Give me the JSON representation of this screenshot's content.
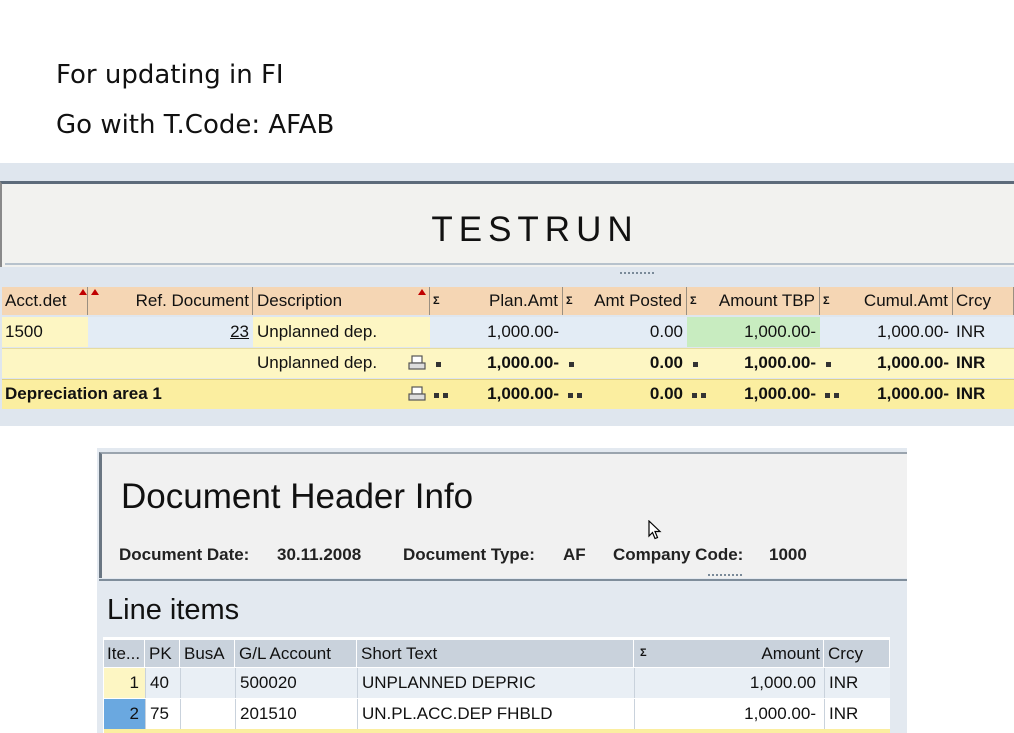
{
  "slide": {
    "line1": "For updating in FI",
    "line2": "Go with T.Code: AFAB"
  },
  "test_run": {
    "title": "TESTRUN",
    "columns": {
      "acct_det": "Acct.det",
      "ref_document": "Ref. Document",
      "description": "Description",
      "plan_amt": "Plan.Amt",
      "amt_posted": "Amt Posted",
      "amount_tbp": "Amount TBP",
      "cumul_amt": "Cumul.Amt",
      "crcy": "Crcy"
    },
    "rows": [
      {
        "acct_det": "1500",
        "ref_document": "23",
        "description": "Unplanned dep.",
        "plan_amt": "1,000.00-",
        "amt_posted": "0.00",
        "amount_tbp": "1,000.00-",
        "cumul_amt": "1,000.00-",
        "crcy": "INR"
      }
    ],
    "subtotal": {
      "description": "Unplanned dep.",
      "plan_amt": "1,000.00-",
      "amt_posted": "0.00",
      "amount_tbp": "1,000.00-",
      "cumul_amt": "1,000.00-",
      "crcy": "INR"
    },
    "total": {
      "label": "Depreciation area  1",
      "plan_amt": "1,000.00-",
      "amt_posted": "0.00",
      "amount_tbp": "1,000.00-",
      "cumul_amt": "1,000.00-",
      "crcy": "INR"
    }
  },
  "doc_header": {
    "title": "Document Header Info",
    "document_date_label": "Document Date:",
    "document_date": "30.11.2008",
    "document_type_label": "Document Type:",
    "document_type": "AF",
    "company_code_label": "Company Code:",
    "company_code": "1000"
  },
  "line_items": {
    "title": "Line items",
    "columns": {
      "item": "Ite...",
      "pk": "PK",
      "busa": "BusA",
      "gl_account": "G/L Account",
      "short_text": "Short Text",
      "amount": "Amount",
      "crcy": "Crcy"
    },
    "rows": [
      {
        "item": "1",
        "pk": "40",
        "busa": "",
        "gl_account": "500020",
        "short_text": "UNPLANNED DEPRIC",
        "amount": "1,000.00",
        "crcy": "INR"
      },
      {
        "item": "2",
        "pk": "75",
        "busa": "",
        "gl_account": "201510",
        "short_text": "UN.PL.ACC.DEP FHBLD",
        "amount": "1,000.00-",
        "crcy": "INR"
      }
    ]
  },
  "colors": {
    "header_orange": "#f5d6b4",
    "row_yellow": "#fdf6c3",
    "ref_blue": "#e3ecf5",
    "tbp_green": "#c8ecc0",
    "table_header_blue": "#c9d2dc",
    "selected_blue": "#6aa8e0"
  }
}
